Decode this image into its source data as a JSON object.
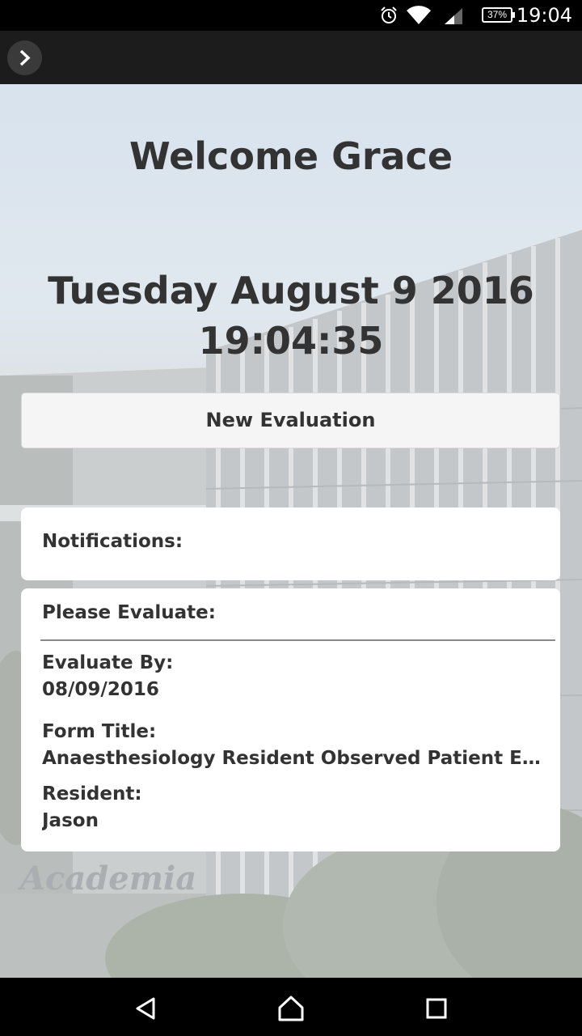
{
  "status_bar": {
    "time": "19:04",
    "battery": "37%",
    "icons": [
      "alarm-icon",
      "wifi-icon",
      "signal-icon",
      "battery-icon"
    ]
  },
  "app_bar": {
    "menu_icon": "chevron-right-icon"
  },
  "main": {
    "welcome": "Welcome Grace",
    "date": "Tuesday August 9 2016",
    "time": "19:04:35",
    "new_evaluation_label": "New Evaluation",
    "notifications_label": "Notifications:",
    "please_evaluate_label": "Please Evaluate:",
    "evaluate_by_label": "Evaluate By:",
    "evaluate_by_value": "08/09/2016",
    "form_title_label": "Form Title:",
    "form_title_value": "Anaesthesiology Resident Observed Patient Encounter",
    "resident_label": "Resident:",
    "resident_value": "Jason",
    "background_sign": "Academia"
  },
  "nav_bar": {
    "icons": [
      "back-icon",
      "home-icon",
      "recents-icon"
    ]
  },
  "colors": {
    "text": "#333333",
    "app_bar": "#1c1c1c",
    "card": "#ffffff",
    "button": "#f5f5f5"
  }
}
